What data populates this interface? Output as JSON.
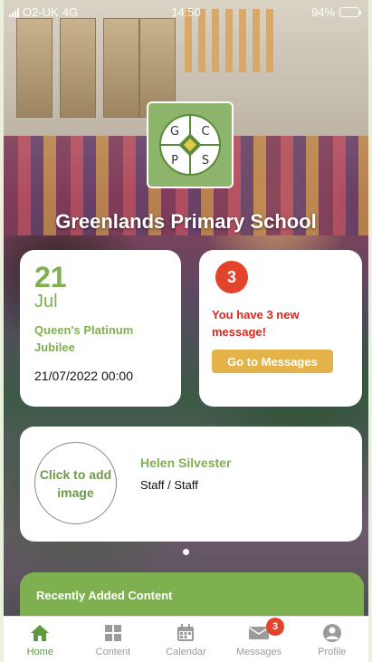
{
  "status_bar": {
    "carrier": "O2-UK",
    "network": "4G",
    "time": "14:50",
    "battery": "94%",
    "battery_level": 0.94
  },
  "logo": {
    "letters": [
      "G",
      "C",
      "P",
      "S"
    ]
  },
  "school": {
    "name": "Greenlands Primary School"
  },
  "event": {
    "day": "21",
    "month": "Jul",
    "title": "Queen's Platinum Jubilee",
    "datetime": "21/07/2022 00:00"
  },
  "messages": {
    "count": "3",
    "text": "You have 3 new message!",
    "button_label": "Go to Messages"
  },
  "profile": {
    "avatar_placeholder": "Click to add image",
    "name": "Helen Silvester",
    "role": "Staff / Staff"
  },
  "pager": {
    "pages": 1,
    "active": 0
  },
  "recent": {
    "heading": "Recently Added Content"
  },
  "tabs": [
    {
      "label": "Home",
      "icon": "home-icon"
    },
    {
      "label": "Content",
      "icon": "grid-icon"
    },
    {
      "label": "Calendar",
      "icon": "calendar-icon"
    },
    {
      "label": "Messages",
      "icon": "envelope-icon",
      "badge": "3"
    },
    {
      "label": "Profile",
      "icon": "person-icon"
    }
  ],
  "colors": {
    "brand_green": "#7fb04f",
    "alert_red": "#e2432a",
    "button_gold": "#e3b34a",
    "tab_inactive": "#9b9b9b"
  }
}
